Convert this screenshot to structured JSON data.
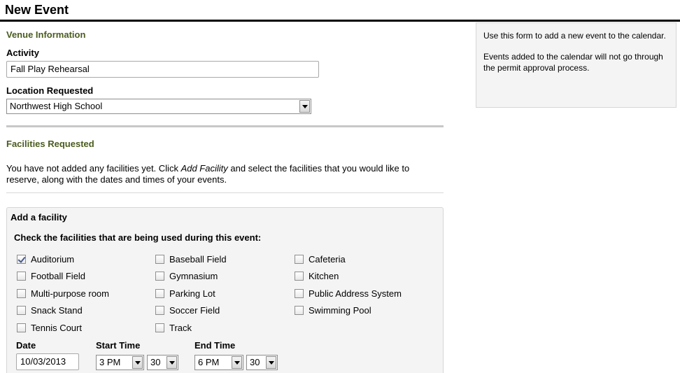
{
  "page": {
    "title": "New Event"
  },
  "venue": {
    "heading": "Venue Information",
    "activity_label": "Activity",
    "activity_value": "Fall Play Rehearsal",
    "location_label": "Location Requested",
    "location_value": "Northwest High School"
  },
  "facilities": {
    "heading": "Facilities Requested",
    "intro_before": "You have not added any facilities yet. Click ",
    "intro_link": "Add Facility",
    "intro_after": " and select the facilities that you would like to reserve, along with the dates and times of your events."
  },
  "add_facility": {
    "title": "Add a facility",
    "subtitle": "Check the facilities that are being used during this event:",
    "options": [
      {
        "label": "Auditorium",
        "checked": true
      },
      {
        "label": "Baseball Field",
        "checked": false
      },
      {
        "label": "Cafeteria",
        "checked": false
      },
      {
        "label": "Football Field",
        "checked": false
      },
      {
        "label": "Gymnasium",
        "checked": false
      },
      {
        "label": "Kitchen",
        "checked": false
      },
      {
        "label": "Multi-purpose room",
        "checked": false
      },
      {
        "label": "Parking Lot",
        "checked": false
      },
      {
        "label": "Public Address System",
        "checked": false
      },
      {
        "label": "Snack Stand",
        "checked": false
      },
      {
        "label": "Soccer Field",
        "checked": false
      },
      {
        "label": "Swimming Pool",
        "checked": false
      },
      {
        "label": "Tennis Court",
        "checked": false
      },
      {
        "label": "Track",
        "checked": false
      }
    ],
    "date_label": "Date",
    "date_value": "10/03/2013",
    "start_label": "Start Time",
    "start_hour": "3 PM",
    "start_minute": "30",
    "end_label": "End Time",
    "end_hour": "6 PM",
    "end_minute": "30"
  },
  "side_note": {
    "line1": "Use this form to add a new event to the calendar.",
    "line2": "Events added to the calendar will not go through the permit approval process."
  }
}
